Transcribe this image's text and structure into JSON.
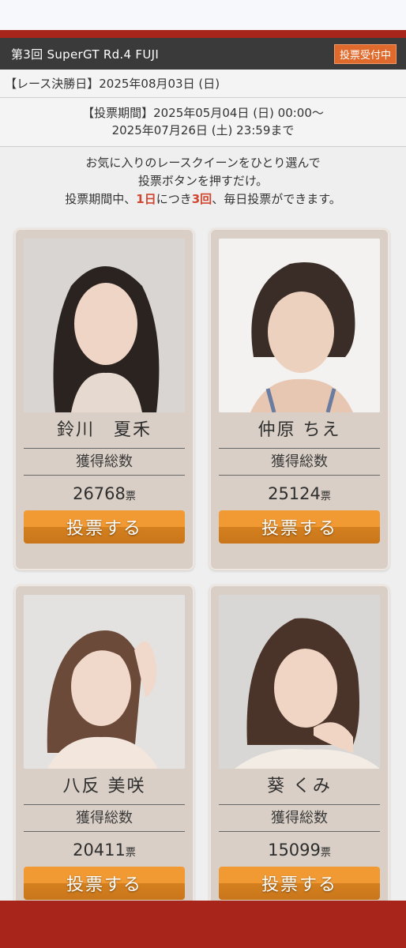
{
  "header": {
    "title": "第3回 SuperGT Rd.4 FUJI",
    "status_badge": "投票受付中"
  },
  "race_date": "【レース決勝日】2025年08月03日 (日)",
  "vote_period": {
    "line1": "【投票期間】2025年05月04日 (日) 00:00〜",
    "line2": "2025年07月26日 (土) 23:59まで"
  },
  "intro": {
    "line1": "お気に入りのレースクイーンをひとり選んで",
    "line2": "投票ボタンを押すだけ。",
    "line3_a": "投票期間中、",
    "line3_b": "1日",
    "line3_c": "につき",
    "line3_d": "3回",
    "line3_e": "、毎日投票ができます。"
  },
  "cards": [
    {
      "name": "鈴川　夏禾",
      "label": "獲得総数",
      "count": "26768",
      "unit": "票",
      "button": "投票する"
    },
    {
      "name": "仲原 ちえ",
      "label": "獲得総数",
      "count": "25124",
      "unit": "票",
      "button": "投票する"
    },
    {
      "name": "八反 美咲",
      "label": "獲得総数",
      "count": "20411",
      "unit": "票",
      "button": "投票する"
    },
    {
      "name": "葵 くみ",
      "label": "獲得総数",
      "count": "15099",
      "unit": "票",
      "button": "投票する"
    }
  ],
  "colors": {
    "brand_red": "#a8251c",
    "accent_orange": "#f19a34",
    "highlight": "#d0462f"
  }
}
